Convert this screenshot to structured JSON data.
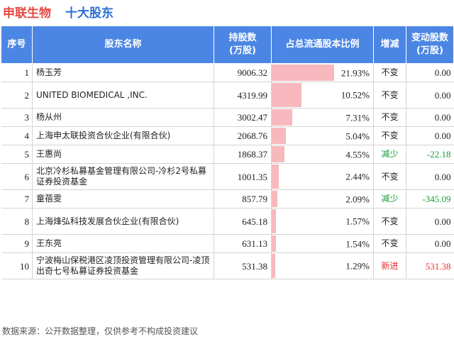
{
  "header": {
    "company": "申联生物",
    "title": "十大股东"
  },
  "columns": [
    "序号",
    "股东名称",
    "持股数\n(万股)",
    "占总流通股本比例",
    "增减",
    "变动股数\n(万股)"
  ],
  "rows": [
    {
      "rank": "1",
      "name": "杨玉芳",
      "shares": "9006.32",
      "ratio": "21.93%",
      "change": "不变",
      "delta": "0.00",
      "tall": false,
      "color": ""
    },
    {
      "rank": "2",
      "name": "UNITED BIOMEDICAL ,INC.",
      "shares": "4319.99",
      "ratio": "10.52%",
      "change": "不变",
      "delta": "0.00",
      "tall": true,
      "color": ""
    },
    {
      "rank": "3",
      "name": "杨从州",
      "shares": "3002.47",
      "ratio": "7.31%",
      "change": "不变",
      "delta": "0.00",
      "tall": false,
      "color": ""
    },
    {
      "rank": "4",
      "name": "上海申太联投资合伙企业(有限合伙)",
      "shares": "2068.76",
      "ratio": "5.04%",
      "change": "不变",
      "delta": "0.00",
      "tall": false,
      "color": ""
    },
    {
      "rank": "5",
      "name": "王惠尚",
      "shares": "1868.37",
      "ratio": "4.55%",
      "change": "减少",
      "delta": "-22.18",
      "tall": false,
      "color": "green"
    },
    {
      "rank": "6",
      "name": "北京冷杉私募基金管理有限公司-冷杉2号私募证券投资基金",
      "shares": "1001.35",
      "ratio": "2.44%",
      "change": "不变",
      "delta": "0.00",
      "tall": true,
      "color": ""
    },
    {
      "rank": "7",
      "name": "童蓓雯",
      "shares": "857.79",
      "ratio": "2.09%",
      "change": "减少",
      "delta": "-345.09",
      "tall": false,
      "color": "green"
    },
    {
      "rank": "8",
      "name": "上海烽弘科技发展合伙企业(有限合伙)",
      "shares": "645.18",
      "ratio": "1.57%",
      "change": "不变",
      "delta": "0.00",
      "tall": true,
      "color": ""
    },
    {
      "rank": "9",
      "name": "王东亮",
      "shares": "631.13",
      "ratio": "1.54%",
      "change": "不变",
      "delta": "0.00",
      "tall": false,
      "color": ""
    },
    {
      "rank": "10",
      "name": "宁波梅山保税港区凌顶投资管理有限公司-凌顶出奇七号私募证券投资基金",
      "shares": "531.38",
      "ratio": "1.29%",
      "change": "新进",
      "delta": "531.38",
      "tall": true,
      "color": "red"
    }
  ],
  "chart_data": {
    "type": "table",
    "ratio_max": 21.93,
    "bar_color": "#f7b9bd",
    "categories": [
      "杨玉芳",
      "UNITED BIOMEDICAL ,INC.",
      "杨从州",
      "上海申太联投资合伙企业(有限合伙)",
      "王惠尚",
      "北京冷杉私募基金管理有限公司-冷杉2号私募证券投资基金",
      "童蓓雯",
      "上海烽弘科技发展合伙企业(有限合伙)",
      "王东亮",
      "宁波梅山保税港区凌顶投资管理有限公司-凌顶出奇七号私募证券投资基金"
    ],
    "series": [
      {
        "values": [
          9006.32,
          4319.99,
          3002.47,
          2068.76,
          1868.37,
          1001.35,
          857.79,
          645.18,
          631.13,
          531.38
        ]
      },
      {
        "values": [
          21.93,
          10.52,
          7.31,
          5.04,
          4.55,
          2.44,
          2.09,
          1.57,
          1.54,
          1.29
        ]
      },
      {
        "values": [
          0.0,
          0.0,
          0.0,
          0.0,
          -22.18,
          0.0,
          -345.09,
          0.0,
          0.0,
          531.38
        ]
      }
    ]
  },
  "footer": "数据来源：公开数据整理，仅供参考不构成投资建议"
}
